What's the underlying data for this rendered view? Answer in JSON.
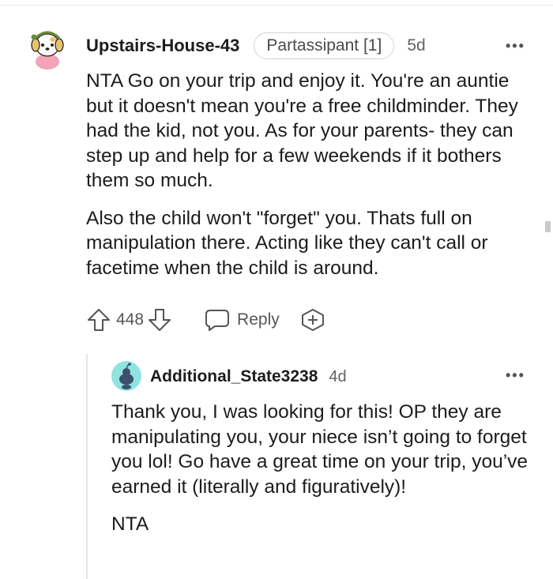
{
  "comment": {
    "username": "Upstairs-House-43",
    "flair": "Partassipant [1]",
    "time": "5d",
    "more_icon": "more-options-icon",
    "paragraphs": [
      "NTA Go on your trip and enjoy it. You're an auntie but it doesn't mean you're a free childminder. They had the kid, not you. As for your parents- they can step up and help for a few weekends if it bothers them so much.",
      "Also the child won't \"forget\" you. Thats full on manipulation there. Acting like they can't call or facetime when the child is around."
    ],
    "votes": "448",
    "reply_label": "Reply"
  },
  "reply": {
    "username": "Additional_State3238",
    "time": "4d",
    "paragraphs": [
      "Thank you, I was looking for this! OP they are manipulating you, your niece isn’t going to forget you lol! Go have a great time on your trip, you’ve earned it (literally and figuratively)!",
      "NTA"
    ]
  },
  "colors": {
    "text": "#1c1c1c",
    "meta": "#5f6368",
    "icons": "#555555",
    "avatar_bg": "#8fe3e0",
    "snoo": "#3d4f6a"
  }
}
